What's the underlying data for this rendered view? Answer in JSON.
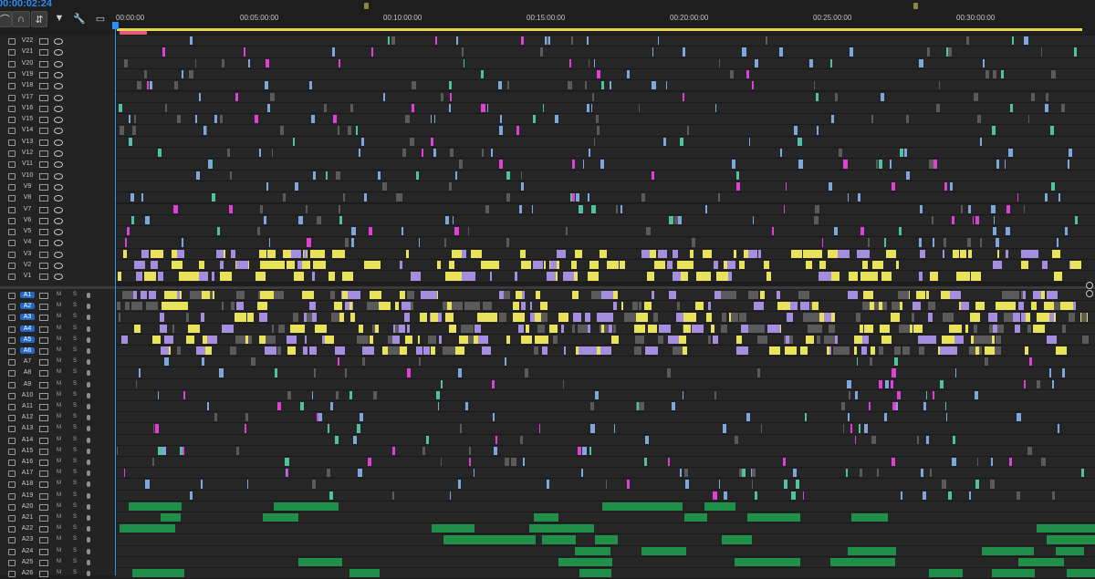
{
  "timecode": "00:00:02:24",
  "ruler_labels": [
    "00:00:00",
    "00:05:00:00",
    "00:10:00:00",
    "00:15:00:00",
    "00:20:00:00",
    "00:25:00:00",
    "00:30:00:00"
  ],
  "video_tracks": [
    "V22",
    "V21",
    "V20",
    "V19",
    "V18",
    "V17",
    "V16",
    "V15",
    "V14",
    "V13",
    "V12",
    "V11",
    "V10",
    "V9",
    "V8",
    "V7",
    "V6",
    "V5",
    "V4",
    "V3",
    "V2",
    "V1"
  ],
  "audio_tracks": [
    "A1",
    "A2",
    "A3",
    "A4",
    "A5",
    "A6",
    "A7",
    "A8",
    "A9",
    "A10",
    "A11",
    "A12",
    "A13",
    "A14",
    "A15",
    "A16",
    "A17",
    "A18",
    "A19",
    "A20",
    "A21",
    "A22",
    "A23",
    "A24",
    "A25",
    "A26"
  ],
  "selected_audio_targets": [
    "A1",
    "A2",
    "A3",
    "A4",
    "A5",
    "A6"
  ],
  "mute_label": "M",
  "solo_label": "S",
  "tools": [
    "snap-icon",
    "linked-selection-icon",
    "add-marker-icon",
    "timeline-settings-icon",
    "captions-icon"
  ],
  "colors": {
    "accent": "#2d8ceb",
    "yellow": "#e9e35c",
    "lavender": "#a58de0",
    "blue": "#7ea7dd",
    "magenta": "#e040d8",
    "teal": "#4fc2a2",
    "green": "#1f8f4a",
    "gray": "#5a5a5a"
  }
}
